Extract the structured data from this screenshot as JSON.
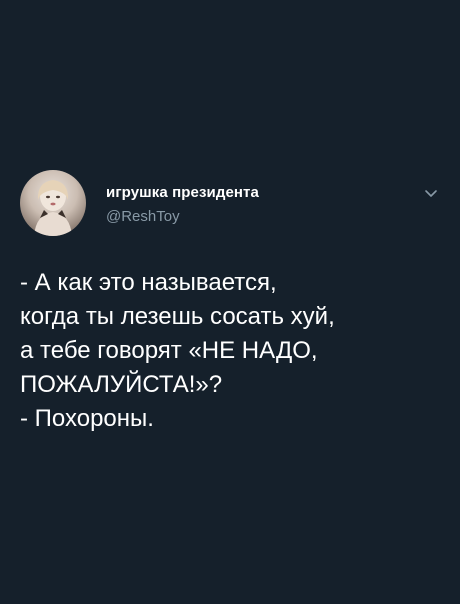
{
  "author": {
    "display_name": "игрушка президента",
    "handle": "@ReshToy"
  },
  "icons": {
    "avatar": "avatar-photo",
    "menu": "chevron-down-icon"
  },
  "tweet": {
    "lines": [
      "- А как это называется,",
      "когда ты лезешь сосать хуй,",
      "а тебе говорят «НЕ НАДО,",
      "ПОЖАЛУЙСТА!»?",
      "- Похороны."
    ]
  },
  "colors": {
    "background": "#15202b",
    "text": "#ffffff",
    "secondary": "#8899a6"
  }
}
